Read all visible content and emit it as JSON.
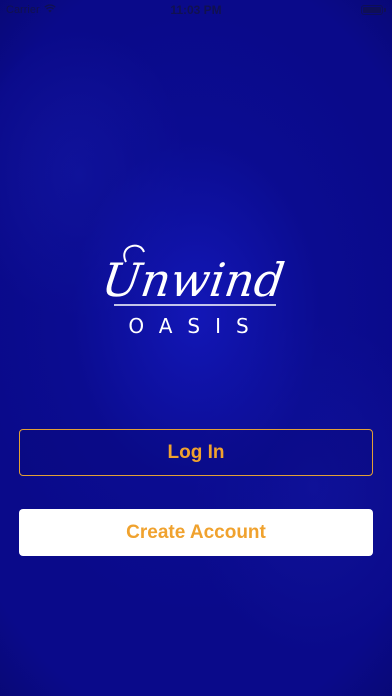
{
  "status_bar": {
    "carrier": "Carrier",
    "time": "11:03 PM",
    "wifi_icon": "wifi-icon",
    "battery_icon": "battery-icon",
    "battery_level": 1.0
  },
  "logo": {
    "script_text": "Unwind",
    "subtitle": "OASIS"
  },
  "actions": {
    "login_label": "Log In",
    "create_account_label": "Create Account"
  },
  "colors": {
    "background": "#0a0a8a",
    "accent": "#f0a22e",
    "button_border": "#e2a035",
    "logo": "#ffffff"
  }
}
